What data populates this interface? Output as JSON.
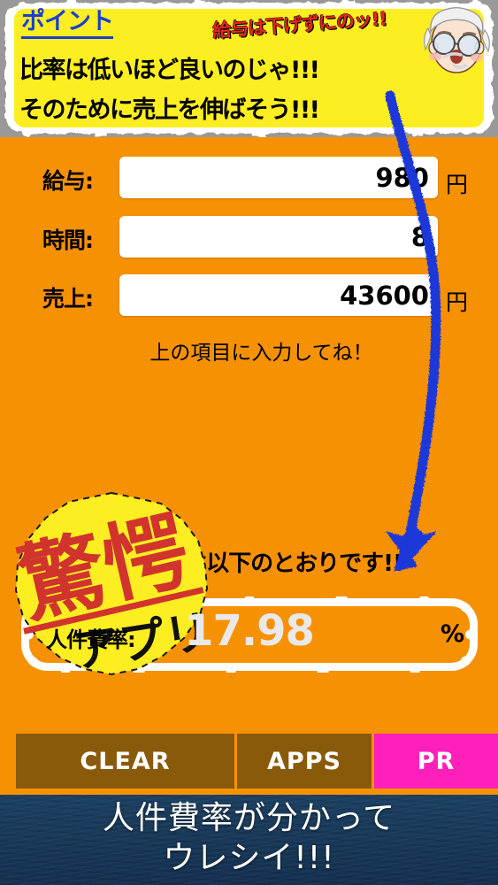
{
  "banner": {
    "point_title": "ポイント",
    "salary_warning": "給与は下げずにのッ!!",
    "line1": "比率は低いほど良いのじゃ!!!",
    "line2": "そのために売上を伸ばそう!!!",
    "character": "grandpa-face-icon"
  },
  "form": {
    "rows": [
      {
        "label": "給与:",
        "value": "980",
        "unit": "円",
        "placeholder": ""
      },
      {
        "label": "時間:",
        "value": "8",
        "unit": "",
        "placeholder": ""
      },
      {
        "label": "売上:",
        "value": "43600",
        "unit": "円",
        "placeholder": ""
      }
    ],
    "hint": "上の項目に入力してね！"
  },
  "stamp": {
    "main_text": "驚愕",
    "sub_text": "アプリ",
    "fill_color": "#fcee21",
    "text_color": "#d0342c"
  },
  "result": {
    "caption": "計算結果は以下のとおりです!!",
    "label": "人件費率:",
    "value": "17.98",
    "unit": "%"
  },
  "buttons": {
    "clear": "CLEAR",
    "apps": "APPS",
    "pr": "PR"
  },
  "footer": {
    "line1": "人件費率が分かって",
    "line2": "ウレシイ!!!"
  },
  "colors": {
    "background_orange": "#f79104",
    "banner_yellow": "#fcee21",
    "point_blue": "#1a3fd4",
    "warning_red": "#e8261c",
    "button_brown": "#8a5a0b",
    "button_magenta": "#ff20bb",
    "footer_navy": "#1d4163",
    "arrow_blue": "#1a37d8",
    "result_value_gray": "#e9e9e9"
  }
}
